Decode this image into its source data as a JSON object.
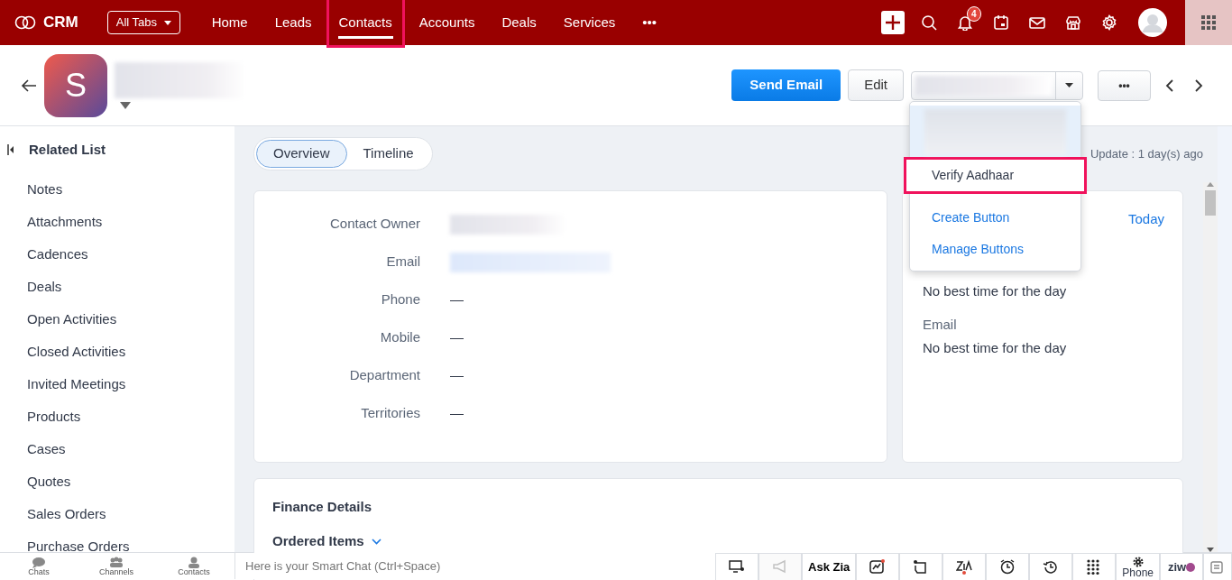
{
  "nav": {
    "brand": "CRM",
    "all_tabs": "All Tabs",
    "more": "•••",
    "notification_count": "4",
    "tabs": [
      {
        "label": "Home",
        "selected": false,
        "highlighted": false
      },
      {
        "label": "Leads",
        "selected": false,
        "highlighted": false
      },
      {
        "label": "Contacts",
        "selected": true,
        "highlighted": true
      },
      {
        "label": "Accounts",
        "selected": false,
        "highlighted": false
      },
      {
        "label": "Deals",
        "selected": false,
        "highlighted": false
      },
      {
        "label": "Services",
        "selected": false,
        "highlighted": false
      }
    ]
  },
  "header": {
    "avatar_letter": "S",
    "send_email": "Send Email",
    "edit": "Edit",
    "more": "•••"
  },
  "dropdown": {
    "items": [
      {
        "kind": "blurred",
        "hovered": true
      },
      {
        "kind": "action",
        "label": "Verify Aadhaar",
        "highlighted": true
      },
      {
        "kind": "link",
        "label": "Create Button",
        "highlighted": false
      },
      {
        "kind": "link",
        "label": "Manage Buttons",
        "highlighted": false
      }
    ]
  },
  "sidebar": {
    "title": "Related List",
    "items": [
      "Notes",
      "Attachments",
      "Cadences",
      "Deals",
      "Open Activities",
      "Closed Activities",
      "Invited Meetings",
      "Products",
      "Cases",
      "Quotes",
      "Sales Orders",
      "Purchase Orders"
    ]
  },
  "view_tabs": [
    {
      "label": "Overview",
      "selected": true
    },
    {
      "label": "Timeline",
      "selected": false
    }
  ],
  "last_update": "Update : 1 day(s) ago",
  "fields": [
    {
      "label": "Contact Owner",
      "kind": "blurred"
    },
    {
      "label": "Email",
      "kind": "blurred-link"
    },
    {
      "label": "Phone",
      "kind": "text",
      "value": "—"
    },
    {
      "label": "Mobile",
      "kind": "text",
      "value": "—"
    },
    {
      "label": "Department",
      "kind": "text",
      "value": "—"
    },
    {
      "label": "Territories",
      "kind": "text",
      "value": "—"
    }
  ],
  "best_time": {
    "link": "Today",
    "entries": [
      {
        "value": "No best time for the day"
      },
      {
        "heading": "Email",
        "value": "No best time for the day"
      }
    ]
  },
  "finance": {
    "title": "Finance Details",
    "section": "Ordered Items"
  },
  "bottom_bar": {
    "tabs": [
      {
        "kind": "chats",
        "label": "Chats"
      },
      {
        "kind": "channels",
        "label": "Channels"
      },
      {
        "kind": "contacts",
        "label": "Contacts"
      }
    ],
    "placeholder": "Here is your Smart Chat (Ctrl+Space)",
    "tools": [
      {
        "kind": "monitor"
      },
      {
        "kind": "megaphone",
        "disabled": true
      },
      {
        "kind": "text",
        "label": "Ask Zia"
      },
      {
        "kind": "chart"
      },
      {
        "kind": "note"
      },
      {
        "kind": "zia"
      },
      {
        "kind": "alarm"
      },
      {
        "kind": "history"
      },
      {
        "kind": "dialpad"
      },
      {
        "kind": "phone",
        "label": "Phone"
      },
      {
        "kind": "ziwo",
        "label": "ziw"
      },
      {
        "kind": "notes"
      }
    ]
  }
}
